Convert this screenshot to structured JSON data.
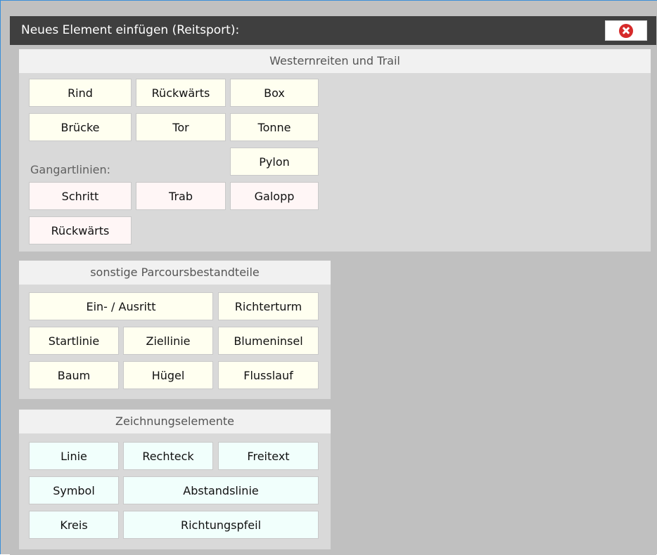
{
  "title": "Neues Element einfügen (Reitsport):",
  "sections": {
    "western": {
      "header": "Westernreiten und Trail",
      "buttons": {
        "rind": "Rind",
        "rueckwaerts": "Rückwärts",
        "box": "Box",
        "bruecke": "Brücke",
        "tor": "Tor",
        "tonne": "Tonne",
        "pylon": "Pylon"
      },
      "gaits_label": "Gangartlinien:",
      "gaits": {
        "schritt": "Schritt",
        "trab": "Trab",
        "galopp": "Galopp",
        "rueckwaerts": "Rückwärts"
      }
    },
    "parcours": {
      "header": "sonstige Parcoursbestandteile",
      "buttons": {
        "ein_ausritt": "Ein- / Ausritt",
        "richterturm": "Richterturm",
        "startlinie": "Startlinie",
        "ziellinie": "Ziellinie",
        "blumeninsel": "Blumeninsel",
        "baum": "Baum",
        "huegel": "Hügel",
        "flusslauf": "Flusslauf"
      }
    },
    "drawing": {
      "header": "Zeichnungselemente",
      "buttons": {
        "linie": "Linie",
        "rechteck": "Rechteck",
        "freitext": "Freitext",
        "symbol": "Symbol",
        "abstandslinie": "Abstandslinie",
        "kreis": "Kreis",
        "richtungspfeil": "Richtungspfeil"
      }
    }
  },
  "colors": {
    "titlebar": "#3f3f3f",
    "close_icon": "#d62a2a",
    "yellow_button": "#fffff0",
    "pink_button": "#fff6f6",
    "mint_button": "#f1fffc"
  }
}
